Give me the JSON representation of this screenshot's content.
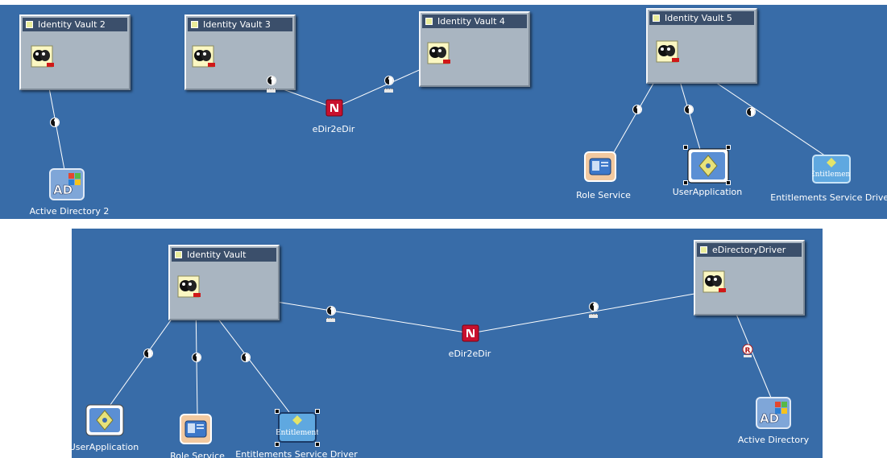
{
  "top_panel": {
    "vaults": [
      {
        "title": "Identity Vault 2"
      },
      {
        "title": "Identity Vault 3"
      },
      {
        "title": "Identity Vault 4"
      },
      {
        "title": "Identity Vault 5"
      }
    ],
    "drivers": {
      "edir": "eDir2eDir",
      "ad": "Active Directory 2",
      "role": "Role Service",
      "userapp": "UserApplication",
      "entitlements": "Entitlements Service Driver"
    }
  },
  "bottom_panel": {
    "vaults": [
      {
        "title": "Identity Vault"
      },
      {
        "title": "eDirectoryDriver"
      }
    ],
    "drivers": {
      "edir": "eDir2eDir",
      "userapp": "UserApplication",
      "role": "Role Service",
      "entitlements": "Entitlements Service Driver",
      "ad": "Active Directory"
    }
  },
  "icon_text": {
    "ad": "AD",
    "entitlement": "Entitlement"
  },
  "colors": {
    "canvas": "#386ca8",
    "vault_body": "#a9b5c1",
    "vault_title": "#3b4f6b",
    "connector": "#ffffff"
  }
}
